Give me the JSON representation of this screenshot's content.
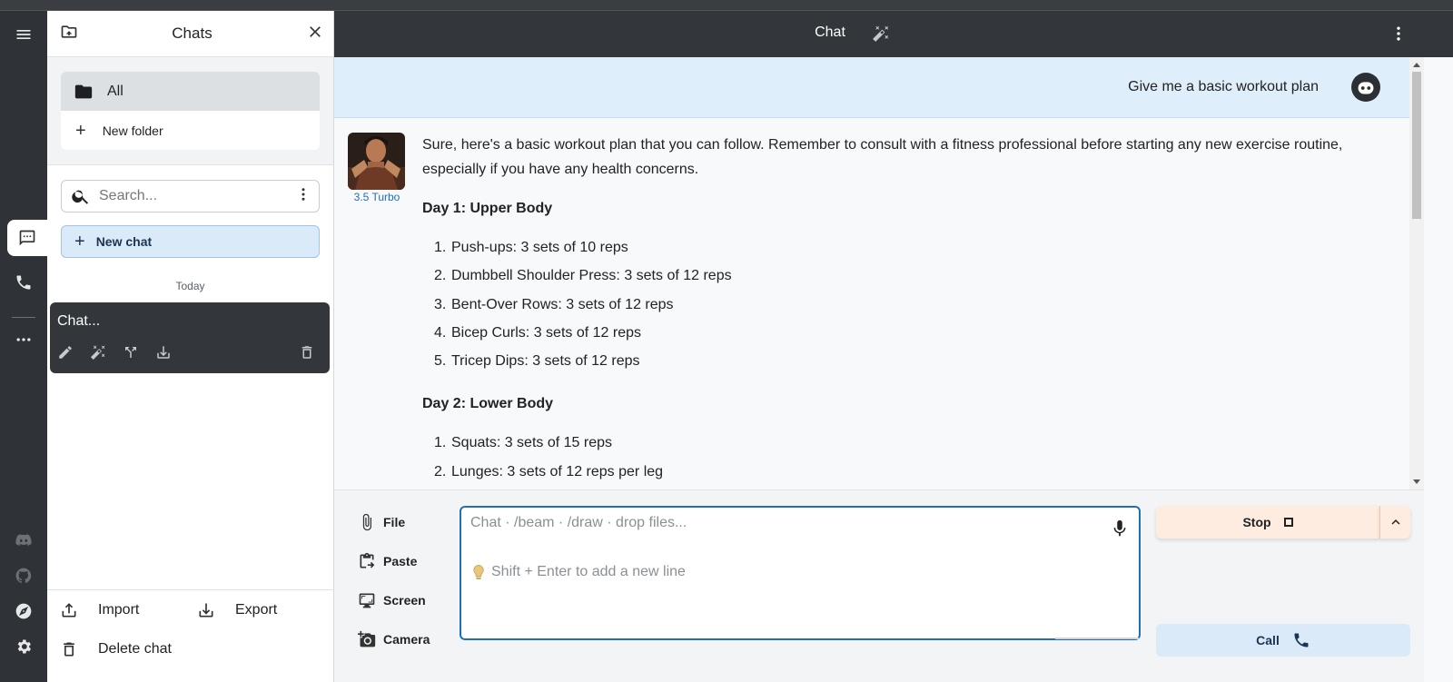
{
  "rail": {
    "icons": [
      "menu-icon",
      "chat-icon",
      "phone-icon",
      "more-icon",
      "discord-icon",
      "github-icon",
      "compass-icon",
      "settings-icon"
    ]
  },
  "drawer": {
    "title": "Chats",
    "folders": {
      "all_label": "All",
      "new_folder_label": "New folder"
    },
    "search_placeholder": "Search...",
    "new_chat_label": "New chat",
    "section_label": "Today",
    "chat_items": [
      {
        "title": "Chat..."
      }
    ],
    "footer": {
      "import_label": "Import",
      "export_label": "Export",
      "delete_label": "Delete chat"
    }
  },
  "topbar": {
    "title": "Chat"
  },
  "conversation": {
    "user_message": "Give me a basic workout plan",
    "assistant": {
      "model_label": "3.5 Turbo",
      "intro": "Sure, here's a basic workout plan that you can follow. Remember to consult with a fitness professional before starting any new exercise routine, especially if you have any health concerns.",
      "sections": [
        {
          "heading": "Day 1: Upper Body",
          "items": [
            "Push-ups: 3 sets of 10 reps",
            "Dumbbell Shoulder Press: 3 sets of 12 reps",
            "Bent-Over Rows: 3 sets of 12 reps",
            "Bicep Curls: 3 sets of 12 reps",
            "Tricep Dips: 3 sets of 12 reps"
          ]
        },
        {
          "heading": "Day 2: Lower Body",
          "items": [
            "Squats: 3 sets of 15 reps",
            "Lunges: 3 sets of 12 reps per leg"
          ]
        }
      ]
    }
  },
  "composer": {
    "attach_buttons": [
      "File",
      "Paste",
      "Screen",
      "Camera"
    ],
    "placeholder": "Chat · /beam · /draw · drop files...",
    "hint": "Shift + Enter to add a new line",
    "stop_label": "Stop",
    "call_label": "Call"
  },
  "colors": {
    "rail_bg": "#2f3338",
    "accent_blue": "#1f6fb5",
    "user_message_bg": "#dfeefb",
    "stop_bg": "#fdecdf",
    "call_bg": "#dbeaf8"
  }
}
